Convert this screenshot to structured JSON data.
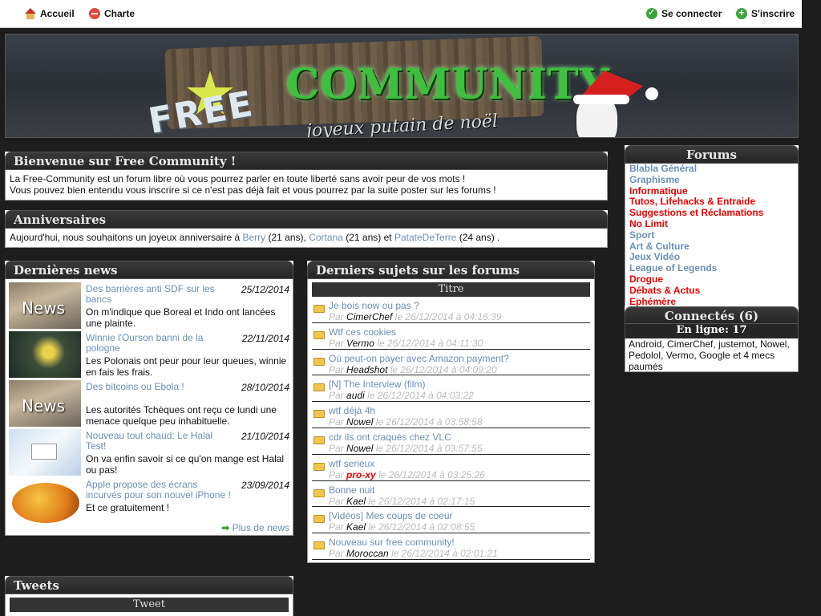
{
  "nav": {
    "home": "Accueil",
    "charter": "Charte",
    "login": "Se connecter",
    "register": "S'inscrire"
  },
  "banner": {
    "free": "FREE",
    "community": "COMMUNITY",
    "tagline": "joyeux putain de noël"
  },
  "welcome": {
    "title": "Bienvenue sur Free Community !",
    "line1": "La Free-Community est un forum libre où vous pourrez parler en toute liberté sans avoir peur de vos mots !",
    "line2": "Vous pouvez bien entendu vous inscrire si ce n'est pas déjà fait et vous pourrez par la suite poster sur les forums !"
  },
  "anniversaries": {
    "title": "Anniversaires",
    "intro": "Aujourd'hui, nous souhaitons un joyeux anniversaire à",
    "people": [
      {
        "name": "Berry",
        "age": "(21 ans),"
      },
      {
        "name": "Cortana",
        "age": "(21 ans) et"
      },
      {
        "name": "PatateDeTerre",
        "age": "(24 ans) ."
      }
    ]
  },
  "news": {
    "title": "Dernières news",
    "more": "Plus de news",
    "items": [
      {
        "title": "Des barrières anti SDF sur les bancs",
        "date": "25/12/2014",
        "desc": "On m'indique que Boreal et Indo ont lancées une plainte."
      },
      {
        "title": "Winnie l'Ourson banni de la pologne",
        "date": "22/11/2014",
        "desc": "Les Polonais ont peur pour leur queues, winnie en fais les frais."
      },
      {
        "title": "Des bitcoins ou Ebola !",
        "date": "28/10/2014",
        "desc": "Les autorités Tchèques ont reçu ce lundi une menace quelque peu inhabituelle."
      },
      {
        "title": "Nouveau tout chaud: Le Halal Test!",
        "date": "21/10/2014",
        "desc": "On va enfin savoir si ce qu'on mange est Halal ou pas!"
      },
      {
        "title": "Apple propose des écrans incurvés pour son nouvel iPhone !",
        "date": "23/09/2014",
        "desc": "Et ce gratuitement !"
      }
    ],
    "thumb_labels": [
      "News",
      "News"
    ]
  },
  "topics": {
    "title": "Derniers sujets sur les forums",
    "column": "Titre",
    "by": "Par",
    "items": [
      {
        "title": "Je bois now ou pas ?",
        "author": "CimerChef",
        "when": "le 26/12/2014 à 04:16:39",
        "highlight": false
      },
      {
        "title": "Wtf ces cookies",
        "author": "Vermo",
        "when": "le 26/12/2014 à 04:11:30",
        "highlight": false
      },
      {
        "title": "Où peut-on payer avec Amazon payment?",
        "author": "Headshot",
        "when": "le 26/12/2014 à 04:09:20",
        "highlight": false
      },
      {
        "title": "[N] The Interview (film)",
        "author": "audi",
        "when": "le 26/12/2014 à 04:03:22",
        "highlight": false
      },
      {
        "title": "wtf déjà 4h",
        "author": "Nowel",
        "when": "le 26/12/2014 à 03:58:58",
        "highlight": false
      },
      {
        "title": "cdr ils ont craqués chez VLC",
        "author": "Nowel",
        "when": "le 26/12/2014 à 03:57:55",
        "highlight": false
      },
      {
        "title": "wtf serieux",
        "author": "pro-xy",
        "when": "le 26/12/2014 à 03:25:26",
        "highlight": true
      },
      {
        "title": "Bonne nuit",
        "author": "Kael",
        "when": "le 26/12/2014 à 02:17:15",
        "highlight": false
      },
      {
        "title": "[Vidéos] Mes coups de coeur",
        "author": "Kael",
        "when": "le 26/12/2014 à 02:08:55",
        "highlight": false
      },
      {
        "title": "Nouveau sur free community!",
        "author": "Moroccan",
        "when": "le 26/12/2014 à 02:01:21",
        "highlight": false
      }
    ]
  },
  "forums": {
    "title": "Forums",
    "items": [
      {
        "label": "Blabla Général",
        "color": "blue"
      },
      {
        "label": "Graphisme",
        "color": "blue"
      },
      {
        "label": "Informatique",
        "color": "red"
      },
      {
        "label": "Tutos, Lifehacks & Entraide",
        "color": "red"
      },
      {
        "label": "Suggestions et Réclamations",
        "color": "red"
      },
      {
        "label": "No Limit",
        "color": "red"
      },
      {
        "label": "Sport",
        "color": "blue"
      },
      {
        "label": "Art & Culture",
        "color": "blue"
      },
      {
        "label": "Jeux Vidéo",
        "color": "blue"
      },
      {
        "label": "League of Legends",
        "color": "blue"
      },
      {
        "label": "Drogue",
        "color": "red"
      },
      {
        "label": "Débats & Actus",
        "color": "red"
      },
      {
        "label": "Ephémère",
        "color": "red"
      }
    ]
  },
  "connected": {
    "title": "Connectés (6)",
    "online": "En ligne: 17",
    "list": "Android, CimerChef, justemot, Nowel, Pedolol, Vermo, Google et 4 mecs paumés"
  },
  "tweets": {
    "title": "Tweets",
    "column": "Tweet"
  },
  "colors": {
    "link": "#6b8fb5",
    "hot": "#e00000",
    "header": "#2a2a2a"
  }
}
